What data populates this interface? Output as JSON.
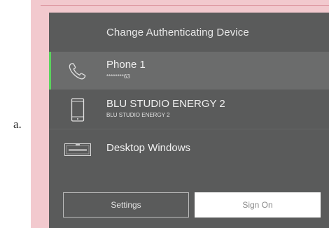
{
  "item_letter": "a.",
  "dialog": {
    "title": "Change Authenticating Device",
    "devices": [
      {
        "name": "Phone 1",
        "detail": "********63",
        "icon": "phone-handset-icon",
        "selected": true
      },
      {
        "name": "BLU STUDIO ENERGY 2",
        "detail": "BLU STUDIO ENERGY 2",
        "icon": "smartphone-icon",
        "selected": false
      },
      {
        "name": "Desktop Windows",
        "icon": "desktop-app-icon",
        "selected": false
      }
    ],
    "buttons": {
      "settings": "Settings",
      "sign_on": "Sign On"
    }
  },
  "colors": {
    "selected_accent": "#5bd25e",
    "panel_bg": "#5a5b5b",
    "frame_bg": "#f2c9ce"
  }
}
